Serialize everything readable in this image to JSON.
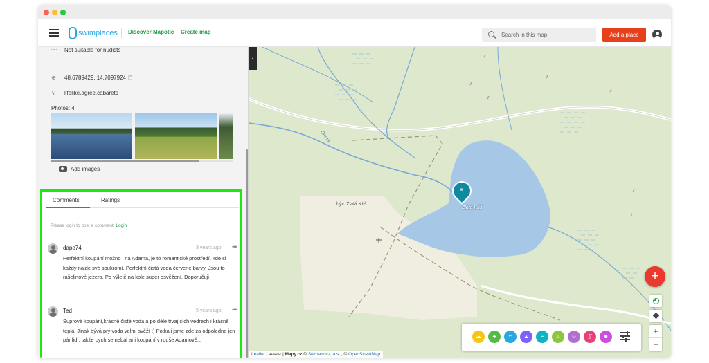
{
  "header": {
    "logo_text": "swimplaces",
    "nav": [
      "Discover Mapotic",
      "Create map"
    ],
    "search_placeholder": "Search in this map",
    "add_place_label": "Add a place"
  },
  "sidebar": {
    "info_rows": [
      {
        "icon": "swim-icon",
        "text": "Not suitable for nudists"
      },
      {
        "icon": "crosshair-icon",
        "text": "48.6789429, 14.7097924"
      },
      {
        "icon": "location-pin-icon",
        "text": "lifelike.agree.cabarets"
      }
    ],
    "photos_label": "Photos: 4",
    "add_images_label": "Add images"
  },
  "comments_panel": {
    "tabs": [
      "Comments",
      "Ratings"
    ],
    "active_tab": "Comments",
    "login_prompt": "Please login to post a comment.",
    "login_link": "Login",
    "comments": [
      {
        "author": "dape74",
        "time": "3 years ago",
        "text": "Perfektní koupání možno i na Adama, je to romantické prostředí, kde si každý najde své soukromí. Perfektní čistá voda červené barvy. Jsou to rašelinové jezera. Po výletě na kole super osvěžení. Doporučuji"
      },
      {
        "author": "Ted",
        "time": "5 years ago",
        "text": "Suprové koupání,krásně čisté voda a po déle trvajících vedrech i krásně teplá. Jinak bývá prý voda velmi svěží ;) Potkali jsme zde za odpoledne jen pár lidí, takže bych se nebál ani koupání v rouše Adamově..."
      }
    ]
  },
  "map": {
    "lake_label": "Zlatá Ktiš",
    "place_label": "býv. Zlatá Ktiš",
    "stream_label": "Černá",
    "fab_label": "+",
    "zoom_in": "+",
    "zoom_out": "−",
    "collapse_label": "‹",
    "filter_colors": [
      "#f5c518",
      "#54b948",
      "#2aa6e0",
      "#7b61ff",
      "#0eb3c4",
      "#8cc63f",
      "#b06fd1",
      "#e8407a",
      "#c94fe0"
    ],
    "attribution": {
      "leaflet": "Leaflet",
      "mapotic": "MAPOTIC",
      "mapy": "Mapy.cz",
      "seznam": "Seznam.cz, a.s.",
      "osm": "OpenStreetMap",
      "copyright": "©"
    }
  }
}
